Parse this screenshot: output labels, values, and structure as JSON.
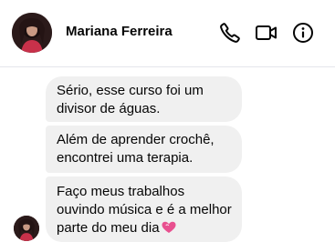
{
  "contact": {
    "name": "Mariana Ferreira",
    "avatar_icon": "profile-photo"
  },
  "header_actions": {
    "call_icon": "phone-icon",
    "video_icon": "video-camera-icon",
    "info_icon": "info-icon"
  },
  "messages": [
    {
      "lines": [
        "Sério, esse curso foi um",
        "divisor de águas."
      ]
    },
    {
      "lines": [
        "Além de aprender crochê,",
        "encontrei uma terapia."
      ]
    },
    {
      "lines": [
        "Faço meus trabalhos",
        "ouvindo música e é a melhor",
        "parte do meu dia"
      ],
      "emoji": "sparkling-heart-icon"
    }
  ],
  "colors": {
    "bubble_bg": "#f0f0f0",
    "text": "#050505",
    "heart": "#e8508f",
    "divider": "#e4e6eb"
  }
}
